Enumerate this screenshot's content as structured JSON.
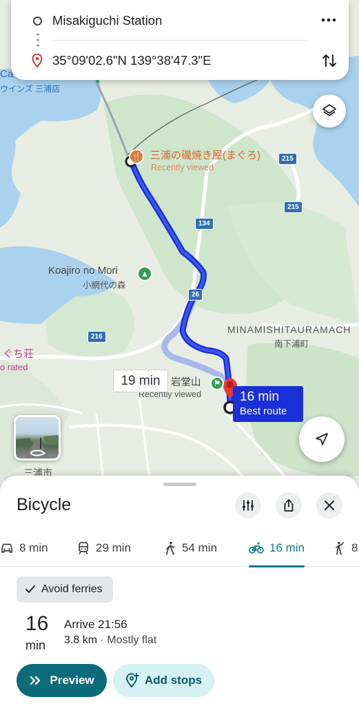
{
  "route_card": {
    "origin": "Misakiguchi Station",
    "destination": "35°09'02.6\"N 139°38'47.3\"E",
    "more_icon": "more-horizontal-icon",
    "swap_icon": "swap-vertical-icon"
  },
  "map": {
    "pois": {
      "restaurant_name": "三浦の磯焼き屋(まぐろ)",
      "restaurant_sub": "Recently viewed",
      "park_name": "Koajiro no Mori",
      "park_sub": "小網代の森",
      "temple_name": "岩堂山",
      "temple_sub": "Recently viewed"
    },
    "places": {
      "town_caps": "MINAMISHITAURAMACH",
      "town_jp": "南下浦町",
      "hotel_name": "ぐち荘",
      "hotel_sub": "o rated",
      "cafe_top": "Ca",
      "cafe_sub": "ウインズ 三浦店",
      "city_bottom": "三浦市"
    },
    "road_numbers": [
      "215",
      "215",
      "134",
      "26",
      "216"
    ],
    "alt_route_time": "19 min",
    "best_route": {
      "time": "16 min",
      "label": "Best route"
    },
    "route_color": "#1a30d6",
    "alt_route_color": "#a9b8e8"
  },
  "sheet": {
    "title": "Bicycle",
    "tabs": [
      {
        "icon": "car-icon",
        "label": "8 min"
      },
      {
        "icon": "train-icon",
        "label": "29 min"
      },
      {
        "icon": "walk-icon",
        "label": "54 min"
      },
      {
        "icon": "bicycle-icon",
        "label": "16 min",
        "active": true
      },
      {
        "icon": "rideshare-icon",
        "label": "8"
      }
    ],
    "avoid_chip": "Avoid ferries",
    "duration": {
      "value": "16",
      "unit": "min"
    },
    "arrive": "Arrive 21:56",
    "distance": "3.8 km",
    "separator": "·",
    "terrain": "Mostly flat",
    "preview_label": "Preview",
    "add_stops_label": "Add stops",
    "accent_color": "#0b6b79"
  }
}
